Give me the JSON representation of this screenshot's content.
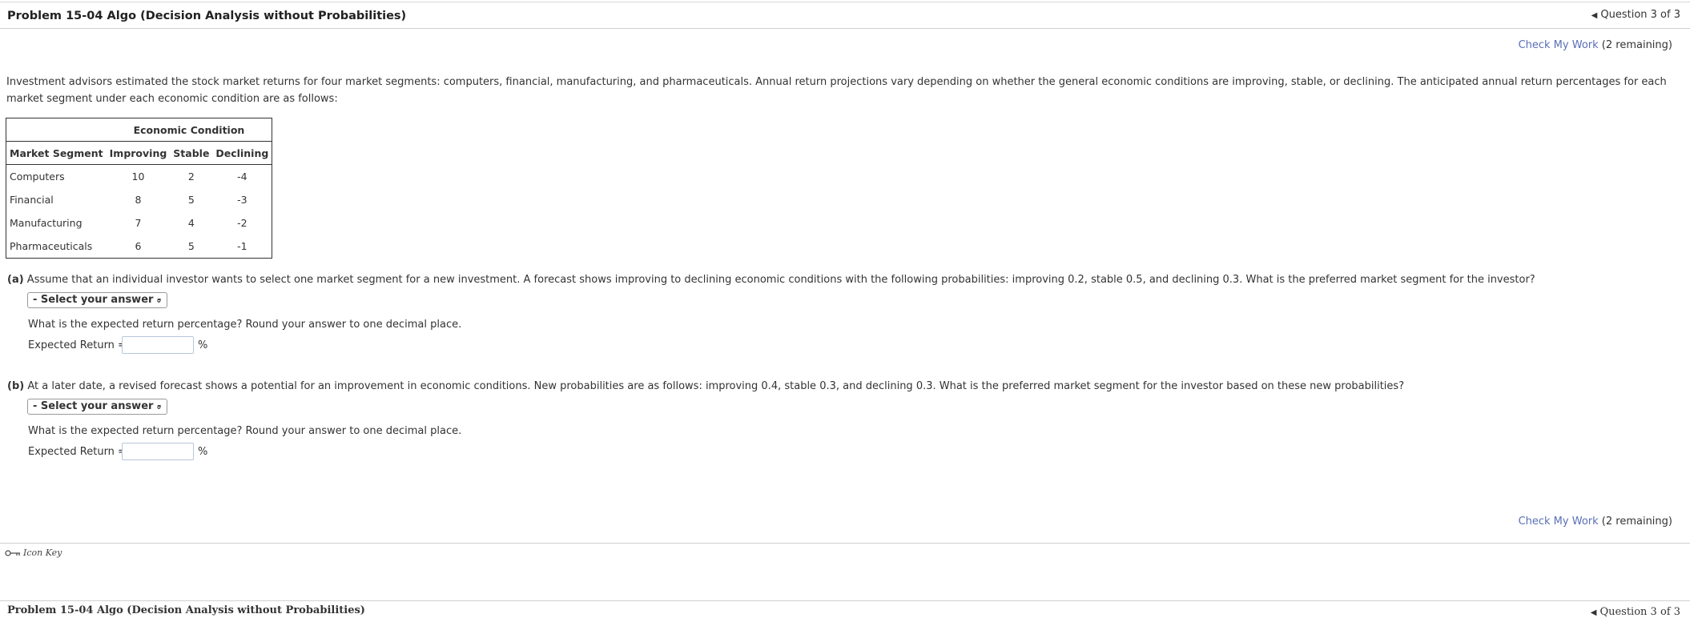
{
  "header": {
    "title": "Problem 15-04 Algo (Decision Analysis without Probabilities)",
    "question_nav": "Question 3 of 3"
  },
  "check_work": {
    "link": "Check My Work",
    "remaining": "(2 remaining)"
  },
  "intro": "Investment advisors estimated the stock market returns for four market segments: computers, financial, manufacturing, and pharmaceuticals. Annual return projections vary depending on whether the general economic conditions are improving, stable, or declining. The anticipated annual return percentages for each market segment under each economic condition are as follows:",
  "table": {
    "group_header": "Economic Condition",
    "columns": [
      "Market Segment",
      "Improving",
      "Stable",
      "Declining"
    ],
    "rows": [
      [
        "Computers",
        "10",
        "2",
        "-4"
      ],
      [
        "Financial",
        "8",
        "5",
        "-3"
      ],
      [
        "Manufacturing",
        "7",
        "4",
        "-2"
      ],
      [
        "Pharmaceuticals",
        "6",
        "5",
        "-1"
      ]
    ]
  },
  "part_a": {
    "label": "(a)",
    "question": "Assume that an individual investor wants to select one market segment for a new investment. A forecast shows improving to declining economic conditions with the following probabilities: improving 0.2, stable 0.5, and declining 0.3. What is the preferred market segment for the investor?",
    "select_value": "- Select your answer -",
    "sub_question": "What is the expected return percentage? Round your answer to one decimal place.",
    "er_label": "Expected Return =",
    "er_value": "",
    "unit": "%"
  },
  "part_b": {
    "label": "(b)",
    "question": "At a later date, a revised forecast shows a potential for an improvement in economic conditions. New probabilities are as follows: improving 0.4, stable 0.3, and declining 0.3. What is the preferred market segment for the investor based on these new probabilities?",
    "select_value": "- Select your answer -",
    "sub_question": "What is the expected return percentage? Round your answer to one decimal place.",
    "er_label": "Expected Return =",
    "er_value": "",
    "unit": "%"
  },
  "footer": {
    "icon_key": "Icon Key",
    "title": "Problem 15-04 Algo (Decision Analysis without Probabilities)",
    "question_nav": "Question 3 of 3"
  }
}
